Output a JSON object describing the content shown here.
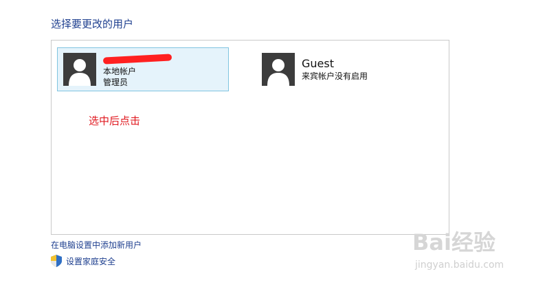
{
  "heading": "选择要更改的用户",
  "users": [
    {
      "name": "",
      "type": "本地帐户",
      "role": "管理员",
      "selected": true,
      "name_redacted": true
    },
    {
      "name": "Guest",
      "status": "来宾帐户没有启用",
      "selected": false
    }
  ],
  "annotation": "选中后点击",
  "links": {
    "add_user": "在电脑设置中添加新用户",
    "family_safety": "设置家庭安全"
  },
  "watermark": {
    "brand": "Bai经验",
    "url": "jingyan.baidu.com"
  },
  "colors": {
    "link": "#1e3f8f",
    "annotation": "#e0181f",
    "selected_bg": "#e5f3fb",
    "selected_border": "#7fc4e0",
    "avatar_bg": "#3c3c3c"
  }
}
